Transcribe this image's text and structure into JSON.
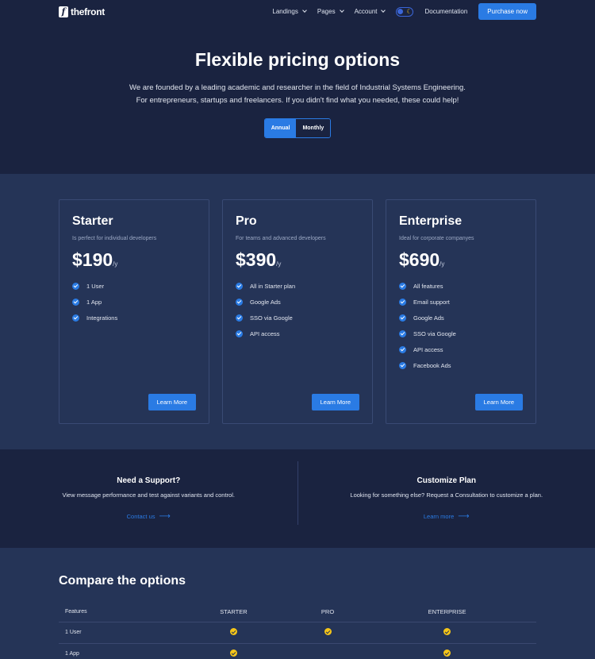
{
  "nav": {
    "logo_letter": "f",
    "logo_text": "thefront",
    "items": [
      "Landings",
      "Pages",
      "Account"
    ],
    "documentation": "Documentation",
    "purchase": "Purchase now"
  },
  "hero": {
    "title": "Flexible pricing options",
    "line1": "We are founded by a leading academic and researcher in the field of Industrial Systems Engineering.",
    "line2": "For entrepreneurs, startups and freelancers. If you didn't find what you needed, these could help!",
    "toggle_annual": "Annual",
    "toggle_monthly": "Monthly"
  },
  "plans": [
    {
      "name": "Starter",
      "desc": "Is perfect for individual developers",
      "price": "$190",
      "per": "/y",
      "features": [
        "1 User",
        "1 App",
        "Integrations"
      ],
      "cta": "Learn More"
    },
    {
      "name": "Pro",
      "desc": "For teams and advanced developers",
      "price": "$390",
      "per": "/y",
      "features": [
        "All in Starter plan",
        "Google Ads",
        "SSO via Google",
        "API access"
      ],
      "cta": "Learn More"
    },
    {
      "name": "Enterprise",
      "desc": "Ideal for corporate companyes",
      "price": "$690",
      "per": "/y",
      "features": [
        "All features",
        "Email support",
        "Google Ads",
        "SSO via Google",
        "API access",
        "Facebook Ads"
      ],
      "cta": "Learn More"
    }
  ],
  "support": {
    "left": {
      "title": "Need a Support?",
      "text": "View message performance and test against variants and control.",
      "link": "Contact us"
    },
    "right": {
      "title": "Customize Plan",
      "text": "Looking for something else? Request a Consultation to customize a plan.",
      "link": "Learn more"
    }
  },
  "compare": {
    "title": "Compare the options",
    "headers": [
      "Features",
      "STARTER",
      "PRO",
      "ENTERPRISE"
    ],
    "rows": [
      {
        "feature": "1 User",
        "starter": true,
        "pro": true,
        "enterprise": true
      },
      {
        "feature": "1 App",
        "starter": true,
        "pro": false,
        "enterprise": true
      }
    ]
  },
  "colors": {
    "accent": "#2a7be4",
    "check_yellow": "#f5c518",
    "bg_dark": "#1a2340",
    "bg_mid": "#253457"
  }
}
